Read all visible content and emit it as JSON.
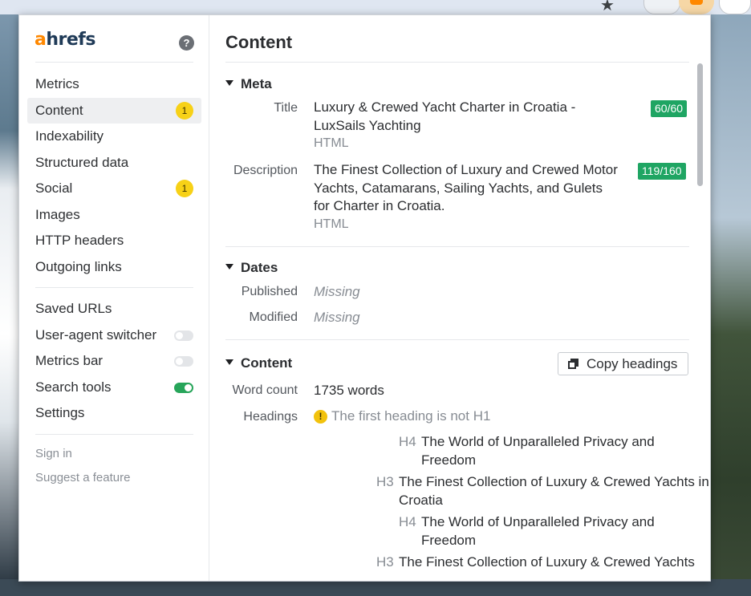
{
  "brand": {
    "logo_a": "a",
    "logo_rest": "hrefs",
    "accent": "#ff8800"
  },
  "sidebar": {
    "nav": [
      {
        "label": "Metrics"
      },
      {
        "label": "Content",
        "badge": "1"
      },
      {
        "label": "Indexability"
      },
      {
        "label": "Structured data"
      },
      {
        "label": "Social",
        "badge": "1"
      },
      {
        "label": "Images"
      },
      {
        "label": "HTTP headers"
      },
      {
        "label": "Outgoing links"
      }
    ],
    "tools": [
      {
        "label": "Saved URLs"
      },
      {
        "label": "User-agent switcher",
        "toggle": "off"
      },
      {
        "label": "Metrics bar",
        "toggle": "off"
      },
      {
        "label": "Search tools",
        "toggle": "on"
      },
      {
        "label": "Settings"
      }
    ],
    "footer": {
      "sign_in": "Sign in",
      "suggest": "Suggest a feature"
    }
  },
  "main": {
    "title": "Content",
    "meta": {
      "heading": "Meta",
      "title_label": "Title",
      "title_value": "Luxury & Crewed Yacht Charter in Croatia - LuxSails Yachting",
      "title_source": "HTML",
      "title_badge": "60/60",
      "description_label": "Description",
      "description_value": "The Finest Collection of Luxury and Crewed Motor Yachts, Catamarans, Sailing Yachts, and Gulets for Charter in Croatia.",
      "description_source": "HTML",
      "description_badge": "119/160"
    },
    "dates": {
      "heading": "Dates",
      "published_label": "Published",
      "published_value": "Missing",
      "modified_label": "Modified",
      "modified_value": "Missing"
    },
    "content": {
      "heading": "Content",
      "copy_button": "Copy headings",
      "word_count_label": "Word count",
      "word_count_value": "1735 words",
      "headings_label": "Headings",
      "headings_warning": "The first heading is not H1",
      "headings": [
        {
          "tag": "H4",
          "text": "The World of Unparalleled Privacy and Freedom"
        },
        {
          "tag": "H3",
          "text": "The Finest Collection of Luxury & Crewed Yachts in Croatia"
        },
        {
          "tag": "H4",
          "text": "The World of Unparalleled Privacy and Freedom"
        },
        {
          "tag": "H3",
          "text": "The Finest Collection of Luxury & Crewed Yachts"
        }
      ]
    }
  }
}
